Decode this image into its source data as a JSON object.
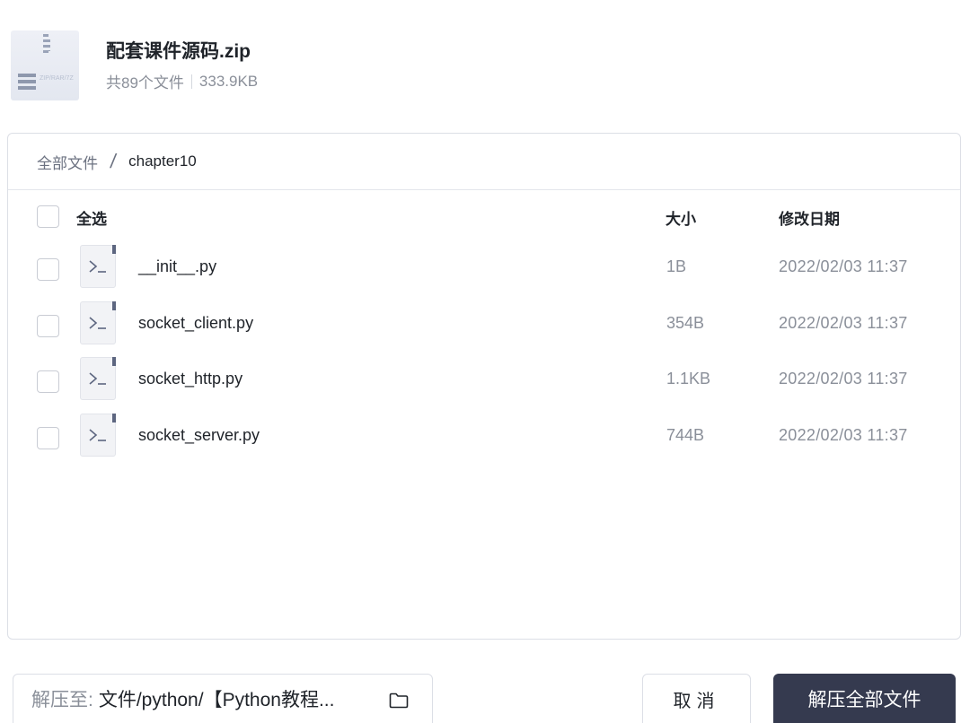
{
  "archive": {
    "name": "配套课件源码.zip",
    "file_count": "共89个文件",
    "size": "333.9KB",
    "icon_text": "ZIP/RAR/7Z"
  },
  "breadcrumb": {
    "root": "全部文件",
    "separator": "/",
    "current": "chapter10"
  },
  "table": {
    "select_all": "全选",
    "col_size": "大小",
    "col_date": "修改日期",
    "rows": [
      {
        "name": "__init__.py",
        "size": "1B",
        "date": "2022/02/03 11:37"
      },
      {
        "name": "socket_client.py",
        "size": "354B",
        "date": "2022/02/03 11:37"
      },
      {
        "name": "socket_http.py",
        "size": "1.1KB",
        "date": "2022/02/03 11:37"
      },
      {
        "name": "socket_server.py",
        "size": "744B",
        "date": "2022/02/03 11:37"
      }
    ]
  },
  "footer": {
    "dest_label": "解压至:",
    "dest_path": "文件/python/【Python教程...",
    "cancel_label": "取消",
    "extract_label": "解压全部文件"
  },
  "icons": {
    "archive": "zip-file-icon",
    "file": "terminal-file-icon",
    "folder": "folder-icon"
  },
  "colors": {
    "primary_button": "#353a4f",
    "muted_text": "#8a8f99",
    "border": "#dcdfe6"
  }
}
